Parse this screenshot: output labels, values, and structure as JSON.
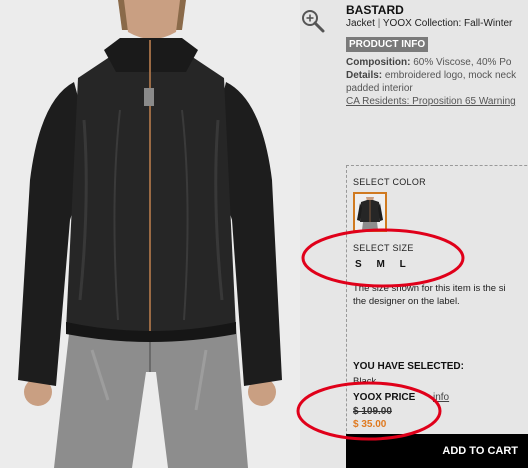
{
  "product": {
    "brand": "BASTARD",
    "category": "Jacket",
    "collection": "YOOX Collection: Fall-Winter",
    "info_button": "PRODUCT INFO",
    "composition_label": "Composition:",
    "composition_value": "60% Viscose, 40% Po",
    "details_label": "Details:",
    "details_value": "embroidered logo, mock neck",
    "details_value_2": "padded interior",
    "prop65_link": "CA Residents: Proposition 65 Warning"
  },
  "selection": {
    "color_label": "SELECT COLOR",
    "size_label": "SELECT SIZE",
    "sizes": [
      "S",
      "M",
      "L"
    ],
    "size_note_line1": "The size shown for this item is the si",
    "size_note_line2": "the designer on the label.",
    "selected_heading": "YOU HAVE SELECTED:",
    "selected_value": "Black"
  },
  "price": {
    "label": "YOOX PRICE",
    "info_link": "info",
    "original": "$ 109.00",
    "sale": "$ 35.00"
  },
  "cart": {
    "label": "ADD TO CART"
  },
  "icons": {
    "zoom": "zoom-in-icon"
  },
  "colors": {
    "accent": "#e07a20",
    "annotation": "#e0001a",
    "cart_bg": "#000000"
  }
}
